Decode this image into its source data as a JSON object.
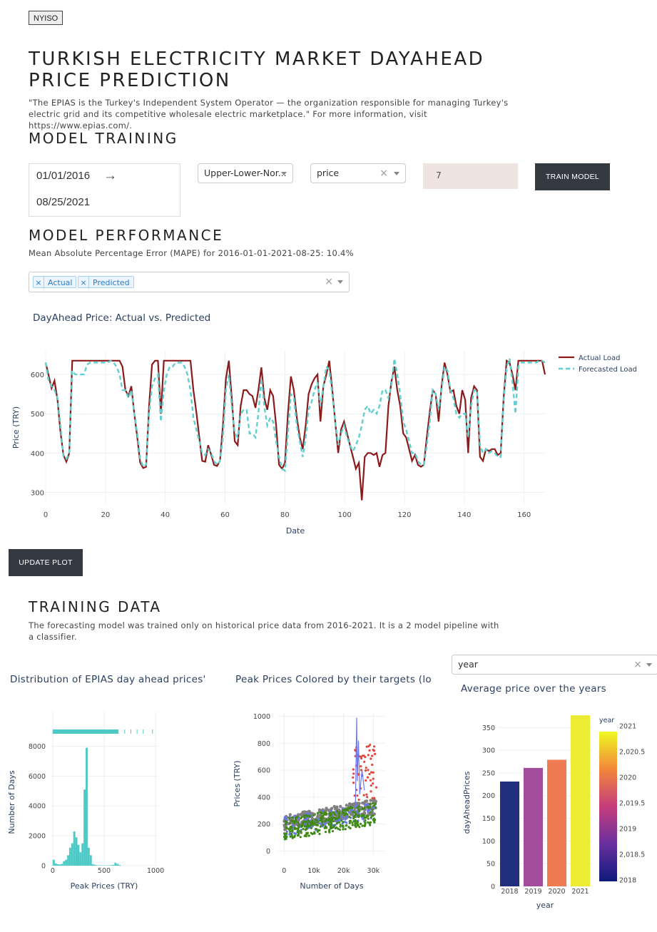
{
  "header": {
    "badge": "NYISO",
    "title": "TURKISH ELECTRICITY MARKET DAYAHEAD PRICE PREDICTION",
    "intro": "\"The EPIAS is the Turkey's Independent System Operator — the organization responsible for managing Turkey's electric grid and its competitive wholesale electric marketplace.\" For more information, visit https://www.epias.com/."
  },
  "training": {
    "heading": "MODEL TRAINING",
    "start_date": "01/01/2016",
    "end_date": "08/25/2021",
    "arrow": "→",
    "model_select": "Upper-Lower-Nor...",
    "target_select": "price",
    "horizon_input": "7",
    "train_button": "TRAIN MODEL"
  },
  "performance": {
    "heading": "MODEL PERFORMANCE",
    "mape_text": "Mean Absolute Percentage Error (MAPE) for 2016-01-01-2021-08-25: 10.4%",
    "series_tags": [
      "Actual",
      "Predicted"
    ],
    "update_button": "UPDATE PLOT"
  },
  "training_data": {
    "heading": "TRAINING DATA",
    "description": "The forecasting model was trained only on historical price data from 2016-2021. It is a 2 model pipeline with a classifier.",
    "group_select": "year"
  },
  "colors": {
    "actual": "#8b1a1a",
    "forecast": "#5fcfcf",
    "teal": "#4ecac6",
    "button": "#353a40"
  },
  "chart_data": [
    {
      "type": "line",
      "title": "DayAhead Price: Actual vs. Predicted",
      "xlabel": "Date",
      "ylabel": "Price (TRY)",
      "xlim": [
        0,
        167
      ],
      "ylim": [
        270,
        660
      ],
      "xticks": [
        "0",
        "20",
        "40",
        "60",
        "80",
        "100",
        "120",
        "140",
        "160"
      ],
      "yticks": [
        "300",
        "400",
        "500",
        "600"
      ],
      "legend": "top-right",
      "series": [
        {
          "name": "Actual Load",
          "values": [
            630,
            598,
            565,
            584,
            535,
            455,
            395,
            378,
            400,
            635,
            635,
            635,
            635,
            635,
            635,
            635,
            635,
            635,
            635,
            635,
            635,
            635,
            635,
            635,
            635,
            635,
            620,
            560,
            545,
            570,
            500,
            440,
            376,
            362,
            365,
            520,
            625,
            635,
            635,
            500,
            635,
            635,
            635,
            635,
            635,
            635,
            635,
            635,
            635,
            635,
            560,
            505,
            440,
            380,
            378,
            420,
            396,
            370,
            367,
            380,
            470,
            590,
            635,
            540,
            430,
            420,
            520,
            560,
            560,
            550,
            545,
            515,
            560,
            618,
            540,
            510,
            560,
            545,
            470,
            370,
            360,
            375,
            500,
            595,
            560,
            490,
            440,
            410,
            470,
            550,
            575,
            590,
            600,
            480,
            570,
            600,
            635,
            560,
            480,
            400,
            460,
            480,
            450,
            420,
            390,
            360,
            375,
            280,
            390,
            400,
            400,
            395,
            400,
            365,
            395,
            400,
            520,
            580,
            620,
            560,
            520,
            450,
            440,
            410,
            380,
            395,
            370,
            365,
            370,
            440,
            505,
            560,
            550,
            480,
            570,
            630,
            600,
            555,
            560,
            520,
            500,
            560,
            535,
            400,
            540,
            570,
            560,
            390,
            380,
            410,
            405,
            410,
            410,
            395,
            400,
            540,
            635,
            630,
            600,
            560,
            635,
            635,
            635,
            635,
            635,
            635,
            635,
            635,
            635,
            600
          ]
        },
        {
          "name": "Forecasted Load",
          "values": [
            630,
            585,
            570,
            560,
            540,
            470,
            390,
            385,
            400,
            610,
            600,
            600,
            600,
            600,
            625,
            630,
            630,
            630,
            630,
            630,
            630,
            630,
            635,
            630,
            620,
            600,
            560,
            560,
            540,
            560,
            500,
            450,
            385,
            365,
            370,
            500,
            570,
            590,
            600,
            480,
            560,
            600,
            620,
            620,
            630,
            630,
            630,
            620,
            600,
            560,
            490,
            460,
            430,
            400,
            395,
            410,
            400,
            380,
            370,
            380,
            440,
            560,
            600,
            520,
            450,
            440,
            500,
            510,
            510,
            450,
            450,
            440,
            500,
            590,
            520,
            470,
            490,
            480,
            430,
            390,
            360,
            355,
            450,
            550,
            540,
            470,
            430,
            390,
            440,
            510,
            530,
            560,
            580,
            520,
            570,
            620,
            610,
            550,
            480,
            420,
            450,
            470,
            440,
            420,
            405,
            420,
            440,
            470,
            510,
            520,
            500,
            510,
            500,
            520,
            560,
            560,
            540,
            570,
            640,
            600,
            550,
            480,
            460,
            430,
            400,
            400,
            380,
            370,
            370,
            420,
            480,
            560,
            550,
            510,
            560,
            620,
            610,
            560,
            540,
            500,
            490,
            500,
            500,
            440,
            520,
            560,
            560,
            420,
            400,
            410,
            400,
            405,
            400,
            390,
            390,
            530,
            620,
            640,
            580,
            500,
            620,
            630,
            630,
            630,
            630,
            630,
            630,
            635,
            635,
            630
          ]
        }
      ]
    },
    {
      "type": "bar",
      "title": "Distribution of EPIAS day ahead prices'",
      "xlabel": "Peak Prices (TRY)",
      "ylabel": "Number of Days",
      "xlim": [
        -20,
        1020
      ],
      "ylim": [
        0,
        8500
      ],
      "xticks": [
        "0",
        "500",
        "1000"
      ],
      "yticks": [
        "0",
        "2000",
        "4000",
        "6000",
        "8000"
      ],
      "bin_width": 20,
      "bin_starts": [
        0,
        20,
        40,
        60,
        80,
        100,
        120,
        140,
        160,
        180,
        200,
        220,
        240,
        260,
        280,
        300,
        320,
        340,
        360,
        380,
        400,
        420,
        440,
        460,
        480,
        500,
        520,
        540,
        560,
        580,
        600,
        620,
        640
      ],
      "values": [
        400,
        150,
        100,
        80,
        120,
        300,
        400,
        700,
        1200,
        1500,
        2300,
        1900,
        1400,
        900,
        1500,
        5100,
        7900,
        1200,
        700,
        100,
        60,
        30,
        20,
        20,
        20,
        20,
        20,
        20,
        40,
        60,
        200,
        120,
        50
      ]
    },
    {
      "type": "scatter",
      "title": "Peak Prices Colored by their targets (low",
      "xlabel": "Number of Days",
      "ylabel": "Prices (TRY)",
      "xlim": [
        -2000,
        34000
      ],
      "ylim": [
        -30,
        1030
      ],
      "xticks": [
        "0",
        "10k",
        "20k",
        "30k"
      ],
      "yticks": [
        "0",
        "200",
        "400",
        "600",
        "800",
        "1000"
      ]
    },
    {
      "type": "bar",
      "title": "Average price over the years",
      "xlabel": "year",
      "ylabel": "dayAheadPrices",
      "categories": [
        "2018",
        "2019",
        "2020",
        "2021"
      ],
      "values": [
        231,
        261,
        279,
        377
      ],
      "ylim": [
        0,
        385
      ],
      "yticks": [
        "0",
        "50",
        "100",
        "150",
        "200",
        "250",
        "300",
        "350"
      ],
      "colorbar_title": "year",
      "colorbar_ticks": [
        "2021",
        "2,020.5",
        "2020",
        "2,019.5",
        "2019",
        "2,018.5",
        "2018"
      ],
      "colors": [
        "#1f2f7e",
        "#a24c9c",
        "#ee7b52",
        "#ecec35"
      ]
    }
  ]
}
